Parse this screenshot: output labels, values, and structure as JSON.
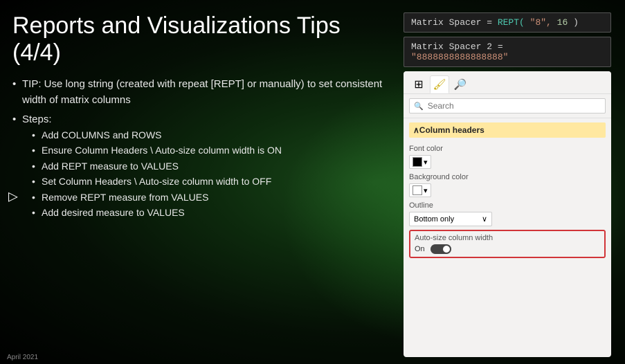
{
  "background": {
    "description": "dark green radial gradient"
  },
  "slide": {
    "title": "Reports and Visualizations Tips (4/4)",
    "bullets": [
      {
        "text": "TIP: Use long string (created with repeat [REPT] or manually) to set consistent width of matrix columns"
      },
      {
        "text": "Steps:",
        "sub": [
          "Add COLUMNS and ROWS",
          "Ensure Column Headers \\ Auto-size column width is ON",
          "Add REPT measure to VALUES",
          "Set Column Headers \\ Auto-size column width to OFF",
          "Remove REPT measure from VALUES",
          "Add desired measure to VALUES"
        ]
      }
    ]
  },
  "formula1": {
    "label": "Matrix Spacer = ",
    "fn": "REPT(",
    "str": " \"8\",",
    "num": " 16",
    "close": " )"
  },
  "formula2": {
    "label": "Matrix Spacer 2 = ",
    "str": "\"8888888888888888\""
  },
  "pbi_panel": {
    "tabs": [
      {
        "icon": "⊞",
        "label": "fields-tab",
        "active": false
      },
      {
        "icon": "🖌",
        "label": "format-tab",
        "active": true
      },
      {
        "icon": "🔍",
        "label": "analytics-tab",
        "active": false
      }
    ],
    "search": {
      "placeholder": "Search",
      "icon": "search-icon"
    },
    "section": {
      "label": "Column headers",
      "chevron": "∧"
    },
    "font_color": {
      "label": "Font color",
      "swatch": "#000000"
    },
    "background_color": {
      "label": "Background color",
      "swatch": "#ffffff"
    },
    "outline": {
      "label": "Outline",
      "value": "Bottom only",
      "chevron": "∨"
    },
    "autosize": {
      "label": "Auto-size column width",
      "toggle_label": "On",
      "toggle_state": true
    }
  },
  "cursor": "▷",
  "bottom_label": "April 2021"
}
